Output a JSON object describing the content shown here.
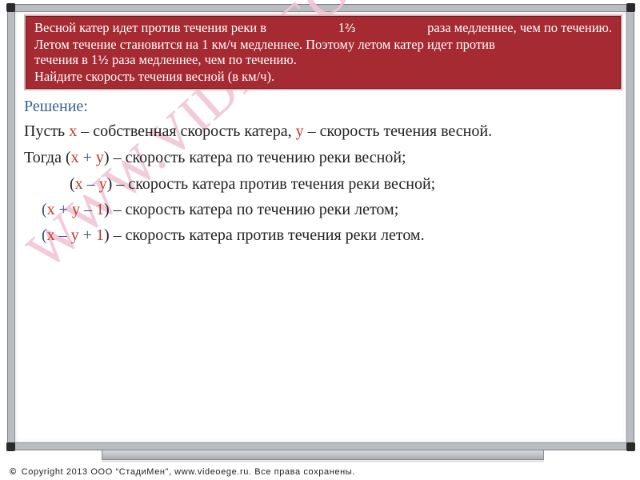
{
  "problem": {
    "line1_start": "Весной катер идет против течения реки в",
    "line1_whole": "1",
    "line1_frac": "²⁄₃",
    "line1_end": "раза медленнее, чем по течению.",
    "line2": "Летом течение становится на 1 км/ч медленнее. Поэтому летом катер идет против",
    "line3_start": "течения в",
    "line3_whole": "1",
    "line3_frac": "¹⁄₂",
    "line3_end": "раза медленнее, чем по течению.",
    "line4": "Найдите скорость течения весной (в км/ч)."
  },
  "solution": {
    "heading": "Решение:",
    "row1": {
      "p1": "Пусть ",
      "x": "x",
      "p2": " – собственная скорость катера, ",
      "y": "y",
      "p3": " – скорость течения весной."
    },
    "row2": {
      "p1": "Тогда (",
      "x": "x",
      "op": " + ",
      "y": "y",
      "p2": ") – скорость катера по течению реки весной;"
    },
    "row3": {
      "p1": "(",
      "x": "x",
      "op": " – ",
      "y": "y",
      "p2": ") – скорость катера против течения реки весной;"
    },
    "row4": {
      "p1": "(",
      "x": "x",
      "op1": " + ",
      "y": "y",
      "op2": " – ",
      "one": "1",
      "p2": ") – скорость катера по течению реки летом;"
    },
    "row5": {
      "p1": "(",
      "x": "x",
      "op1": " – ",
      "y": "y",
      "op2": " + ",
      "one": "1",
      "p2": ") – скорость катера против течения реки летом."
    }
  },
  "watermark": "WWW.VIDEOEGE.RU",
  "footer": {
    "copyright_symbol": "©",
    "text": "Copyright 2013   ООО “СтадиМен”, www.videoege.ru.   Все права сохранены."
  },
  "colors": {
    "problem_bg": "#a52a32",
    "heading": "#3a5f93",
    "variable_red": "#c0392b",
    "operator_blue": "#2d4f8a",
    "watermark": "#f1c6d8"
  }
}
